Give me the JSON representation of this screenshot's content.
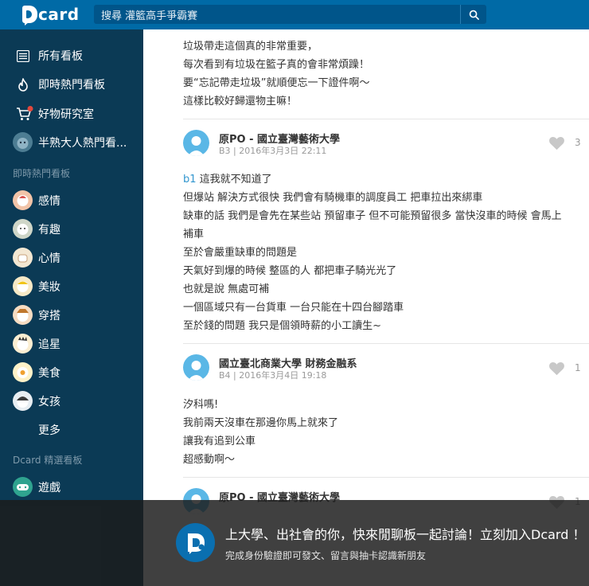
{
  "header": {
    "logo_text": "card",
    "search_placeholder": "搜尋 灌籃高手爭霸賽"
  },
  "sidebar": {
    "top_items": [
      {
        "label": "所有看板",
        "icon": "list-icon"
      },
      {
        "label": "即時熱門看板",
        "icon": "flame-icon"
      },
      {
        "label": "好物研究室",
        "icon": "cart-icon"
      },
      {
        "label": "半熟大人熱門看...",
        "icon": "board-avatar"
      }
    ],
    "section_hot": "即時熱門看板",
    "hot_items": [
      {
        "label": "感情"
      },
      {
        "label": "有趣"
      },
      {
        "label": "心情"
      },
      {
        "label": "美妝"
      },
      {
        "label": "穿搭"
      },
      {
        "label": "追星"
      },
      {
        "label": "美食"
      },
      {
        "label": "女孩"
      }
    ],
    "more_label": "更多",
    "section_featured": "Dcard 精選看板",
    "featured_items": [
      {
        "label": "遊戲"
      }
    ]
  },
  "comments": [
    {
      "lines": [
        "垃圾帶走這個真的非常重要，",
        "每次看到有垃圾在籃子真的會非常煩躁！",
        "要“忘記帶走垃圾”就順便忘一下證件啊～",
        "這樣比較好歸還物主嘛！"
      ]
    },
    {
      "author": "原PO - 國立臺灣藝術大學",
      "floor_time": "B3 | 2016年3月3日 22:11",
      "likes": "3",
      "reply_ref": "b1",
      "first_line_rest": " 這我就不知道了",
      "lines": [
        "但爆站 解決方式很快  我們會有騎機車的調度員工 把車拉出來綁車",
        "缺車的話 我們是會先在某些站 預留車子  但不可能預留很多 當快沒車的時候 會馬上",
        "補車",
        "至於會嚴重缺車的問題是",
        "天氣好到爆的時候  整區的人 都把車子騎光光了",
        "也就是說 無處可補",
        "一個區域只有一台貨車  一台只能在十四台腳踏車",
        "至於錢的問題  我只是個領時薪的小工讀生~"
      ]
    },
    {
      "author": "國立臺北商業大學 財務金融系",
      "floor_time": "B4 | 2016年3月4日 19:18",
      "likes": "1",
      "lines": [
        "汐科嗎!",
        "我前兩天沒車在那邊你馬上就來了",
        "讓我有追到公車",
        "超感動啊～"
      ]
    },
    {
      "author": "原PO - 國立臺灣藝術大學",
      "likes": "1"
    }
  ],
  "overlay": {
    "title": "上大學、出社會的你，快來閒聊板一起討論！立刻加入Dcard ！",
    "subtitle": "完成身份驗證即可發文、留言與抽卡認識新朋友"
  },
  "colors": {
    "header": "#006aa6",
    "sidebar": "#0b3a55",
    "avatar": "#5ab7e6",
    "link": "#3397cf"
  }
}
